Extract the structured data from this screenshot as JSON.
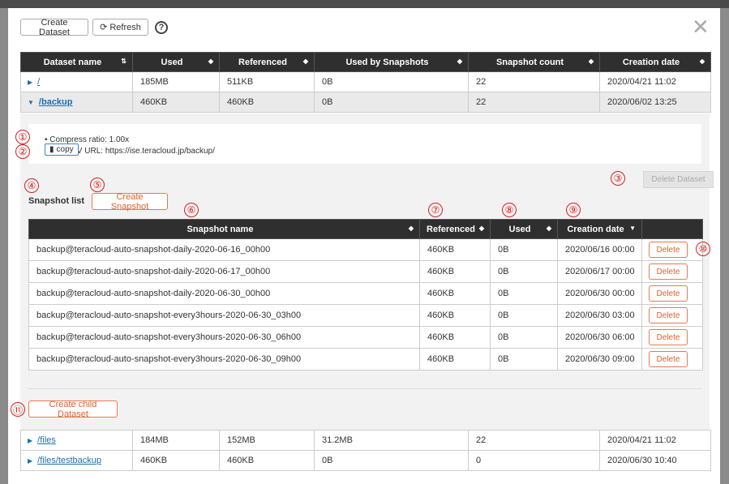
{
  "toolbar": {
    "create_dataset": "Create Dataset",
    "refresh": "Refresh",
    "help": "?"
  },
  "dataset_table": {
    "headers": [
      "Dataset name",
      "Used",
      "Referenced",
      "Used by Snapshots",
      "Snapshot count",
      "Creation date"
    ],
    "rows": [
      {
        "name": "/",
        "used": "185MB",
        "referenced": "511KB",
        "used_by_snapshots": "0B",
        "snapshot_count": "22",
        "created": "2020/04/21 11:02"
      },
      {
        "name": "/backup",
        "used": "460KB",
        "referenced": "460KB",
        "used_by_snapshots": "0B",
        "snapshot_count": "22",
        "created": "2020/06/02 13:25"
      }
    ],
    "rows_after": [
      {
        "name": "/files",
        "used": "184MB",
        "referenced": "152MB",
        "used_by_snapshots": "31.2MB",
        "snapshot_count": "22",
        "created": "2020/04/21 11:02"
      },
      {
        "name": "/files/testbackup",
        "used": "460KB",
        "referenced": "460KB",
        "used_by_snapshots": "0B",
        "snapshot_count": "0",
        "created": "2020/06/30 10:40"
      }
    ]
  },
  "details": {
    "compress_ratio": "• Compress ratio: 1.00x",
    "webdav_url": "• WebDAV URL: https://ise.teracloud.jp/backup/",
    "copy_label": "copy",
    "delete_dataset": "Delete Dataset",
    "snapshot_list_title": "Snapshot list",
    "create_snapshot": "Create Snapshot",
    "create_child_dataset": "Create child Dataset"
  },
  "snapshot_table": {
    "headers": [
      "Snapshot name",
      "Referenced",
      "Used",
      "Creation date"
    ],
    "delete_label": "Delete",
    "rows": [
      {
        "name": "backup@teracloud-auto-snapshot-daily-2020-06-16_00h00",
        "referenced": "460KB",
        "used": "0B",
        "created": "2020/06/16 00:00"
      },
      {
        "name": "backup@teracloud-auto-snapshot-daily-2020-06-17_00h00",
        "referenced": "460KB",
        "used": "0B",
        "created": "2020/06/17 00:00"
      },
      {
        "name": "backup@teracloud-auto-snapshot-daily-2020-06-30_00h00",
        "referenced": "460KB",
        "used": "0B",
        "created": "2020/06/30 00:00"
      },
      {
        "name": "backup@teracloud-auto-snapshot-every3hours-2020-06-30_03h00",
        "referenced": "460KB",
        "used": "0B",
        "created": "2020/06/30 03:00"
      },
      {
        "name": "backup@teracloud-auto-snapshot-every3hours-2020-06-30_06h00",
        "referenced": "460KB",
        "used": "0B",
        "created": "2020/06/30 06:00"
      },
      {
        "name": "backup@teracloud-auto-snapshot-every3hours-2020-06-30_09h00",
        "referenced": "460KB",
        "used": "0B",
        "created": "2020/06/30 09:00"
      }
    ]
  },
  "markers": [
    "①",
    "②",
    "③",
    "④",
    "⑤",
    "⑥",
    "⑦",
    "⑧",
    "⑨",
    "⑩",
    "⑪"
  ],
  "colors": {
    "header_bg": "#2f2f2f",
    "link": "#1a6fb0",
    "accent_orange": "#e06030",
    "marker_red": "#d82020"
  }
}
